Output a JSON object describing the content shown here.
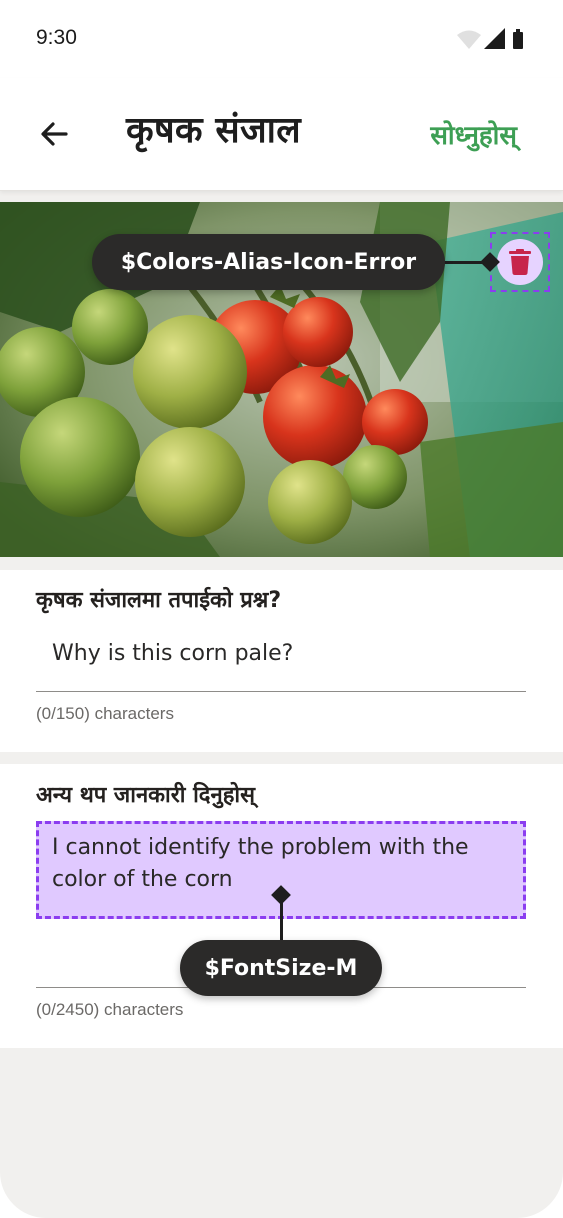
{
  "status_bar": {
    "time": "9:30"
  },
  "app_bar": {
    "title": "कृषक संजाल",
    "action_label": "सोध्नुहोस्"
  },
  "photo": {
    "subject": "tomatoes on vine"
  },
  "question": {
    "label": "कृषक संजालमा तपाईको प्रश्न?",
    "value": "Why is this corn pale?",
    "counter": "(0/150) characters"
  },
  "details": {
    "label": "अन्य थप जानकारी दिनुहोस्",
    "value": "I cannot identify the problem with the color of the corn",
    "counter": "(0/2450) characters"
  },
  "annotations": {
    "icon_token": "$Colors-Alias-Icon-Error",
    "font_token": "$FontSize-M"
  },
  "colors": {
    "accent": "#3d9f54",
    "error_icon": "#c7244a",
    "annotation_highlight": "#e0c9ff",
    "annotation_border": "#8b3df0"
  },
  "icons": {
    "back": "arrow-back-icon",
    "delete": "trash-icon"
  }
}
